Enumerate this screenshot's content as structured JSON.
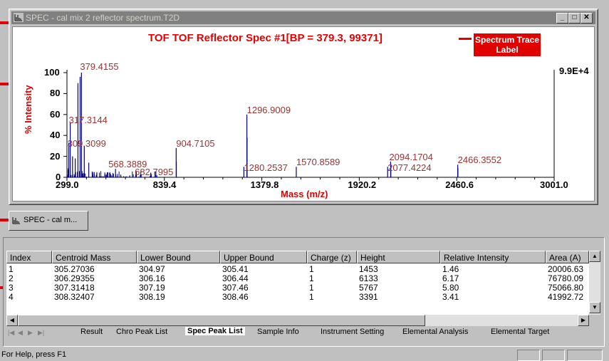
{
  "window": {
    "title": "SPEC - cal mix 2 reflector spectrum.T2D",
    "min": "_",
    "max": "□",
    "close": "✕"
  },
  "plot": {
    "spectrum_title": "TOF TOF Reflector Spec #1[BP = 379.3, 99371]",
    "callout": "Spectrum Trace Label",
    "y_max_label": "9.9E+4",
    "ylabel": "% Intensity",
    "xlabel": "Mass (m/z)"
  },
  "chart_data": {
    "type": "line",
    "xlabel": "Mass (m/z)",
    "ylabel": "% Intensity",
    "xlim": [
      299.0,
      3001.0
    ],
    "ylim": [
      0,
      100
    ],
    "x_ticks": [
      "299.0",
      "839.4",
      "1379.8",
      "1920.2",
      "2460.6",
      "3001.0"
    ],
    "y_ticks": [
      "0",
      "20",
      "40",
      "60",
      "80",
      "100"
    ],
    "peaks": [
      {
        "mz": 305.27,
        "y": 7
      },
      {
        "mz": 306.29,
        "y": 8
      },
      {
        "mz": 307.31,
        "y": 9
      },
      {
        "mz": 308.32,
        "y": 6
      },
      {
        "mz": 309.31,
        "y": 33
      },
      {
        "mz": 317.31,
        "y": 52
      },
      {
        "mz": 330,
        "y": 20
      },
      {
        "mz": 345,
        "y": 18
      },
      {
        "mz": 360,
        "y": 90
      },
      {
        "mz": 372,
        "y": 96
      },
      {
        "mz": 379.42,
        "y": 100
      },
      {
        "mz": 395,
        "y": 30
      },
      {
        "mz": 420,
        "y": 14
      },
      {
        "mz": 450,
        "y": 5
      },
      {
        "mz": 568.39,
        "y": 8
      },
      {
        "mz": 682.8,
        "y": 6
      },
      {
        "mz": 904.71,
        "y": 28
      },
      {
        "mz": 905.71,
        "y": 15
      },
      {
        "mz": 1280.25,
        "y": 10
      },
      {
        "mz": 1296.9,
        "y": 60
      },
      {
        "mz": 1297.9,
        "y": 38
      },
      {
        "mz": 1570.86,
        "y": 10
      },
      {
        "mz": 2077.42,
        "y": 10
      },
      {
        "mz": 2094.17,
        "y": 15
      },
      {
        "mz": 2095.17,
        "y": 11
      },
      {
        "mz": 2466.36,
        "y": 12
      },
      {
        "mz": 2467.36,
        "y": 9
      }
    ],
    "peak_labels": [
      {
        "text": "379.4155",
        "mz": 379.4155,
        "y": 100
      },
      {
        "text": "317.3144",
        "mz": 317.3144,
        "y": 52
      },
      {
        "text": "309.3099",
        "mz": 309.3099,
        "y": 33
      },
      {
        "text": "568.3889",
        "mz": 568.3889,
        "y": 8
      },
      {
        "text": "904.7105",
        "mz": 904.7105,
        "y": 28
      },
      {
        "text": "682.7995",
        "mz": 682.7995,
        "y": 6
      },
      {
        "text": "1296.9009",
        "mz": 1296.9009,
        "y": 60
      },
      {
        "text": "1280.2537",
        "mz": 1280.2537,
        "y": 10
      },
      {
        "text": "1570.8589",
        "mz": 1570.8589,
        "y": 10
      },
      {
        "text": "2094.1704",
        "mz": 2094.1704,
        "y": 15
      },
      {
        "text": "2077.4224",
        "mz": 2077.4224,
        "y": 10
      },
      {
        "text": "2466.3552",
        "mz": 2466.3552,
        "y": 12
      }
    ]
  },
  "minimized_tab": {
    "label": "SPEC - cal m..."
  },
  "table": {
    "columns": [
      "Index",
      "Centroid Mass",
      "Lower Bound",
      "Upper Bound",
      "Charge (z)",
      "Height",
      "Relative Intensity",
      "Area (A)"
    ],
    "rows": [
      [
        "1",
        "305.27036",
        "304.97",
        "305.41",
        "1",
        "1453",
        "1.46",
        "20006.63"
      ],
      [
        "2",
        "306.29355",
        "306.16",
        "306.44",
        "1",
        "6133",
        "6.17",
        "76780.09"
      ],
      [
        "3",
        "307.31418",
        "307.19",
        "307.46",
        "1",
        "5767",
        "5.80",
        "75066.80"
      ],
      [
        "4",
        "308.32407",
        "308.19",
        "308.46",
        "1",
        "3391",
        "3.41",
        "41992.72"
      ]
    ]
  },
  "tabs": [
    "Result",
    "Chro Peak List",
    "Spec Peak List",
    "Sample Info",
    "Instrument Setting",
    "Elemental Analysis",
    "Elemental Target"
  ],
  "active_tab": "Spec Peak List",
  "status": {
    "text": "For Help, press F1"
  },
  "colors": {
    "accent": "#e00000",
    "trace": "#000080",
    "label": "#993333"
  }
}
